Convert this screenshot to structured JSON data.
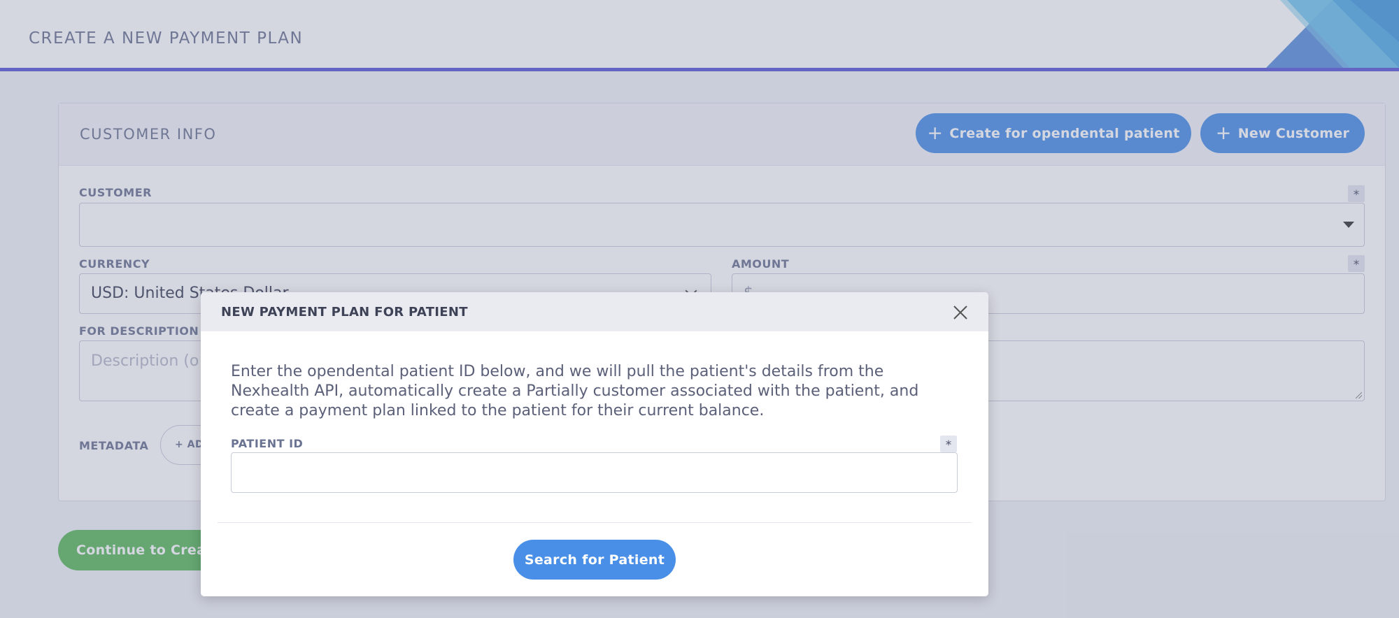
{
  "page": {
    "title": "CREATE A NEW PAYMENT PLAN"
  },
  "customer_info": {
    "title": "CUSTOMER INFO",
    "create_opendental_label": "Create for opendental patient",
    "new_customer_label": "New Customer",
    "customer_label": "CUSTOMER",
    "customer_value": "",
    "currency_label": "CURRENCY",
    "currency_value": "USD: United States Dollar",
    "amount_label": "AMOUNT",
    "amount_prefix": "$",
    "description_label": "FOR DESCRIPTION",
    "description_placeholder": "Description (o",
    "metadata_label": "METADATA",
    "add_metadata_label": "+ ADD",
    "required_mark": "*"
  },
  "continue_label": "Continue to Crea",
  "modal": {
    "title": "NEW PAYMENT PLAN FOR PATIENT",
    "description": "Enter the opendental patient ID below, and we will pull the patient's details from the Nexhealth API, automatically create a Partially customer associated with the patient, and create a payment plan linked to the patient for their current balance.",
    "patient_id_label": "PATIENT ID",
    "patient_id_value": "",
    "required_mark": "*",
    "search_label": "Search for Patient"
  },
  "colors": {
    "primary": "#4a8fe7",
    "success": "#5cb85c",
    "header_accent": "#5a57d6"
  },
  "icons": {
    "close": "close-icon",
    "plus": "plus-icon",
    "caret": "caret-down-icon",
    "chevron": "chevron-down-icon"
  }
}
